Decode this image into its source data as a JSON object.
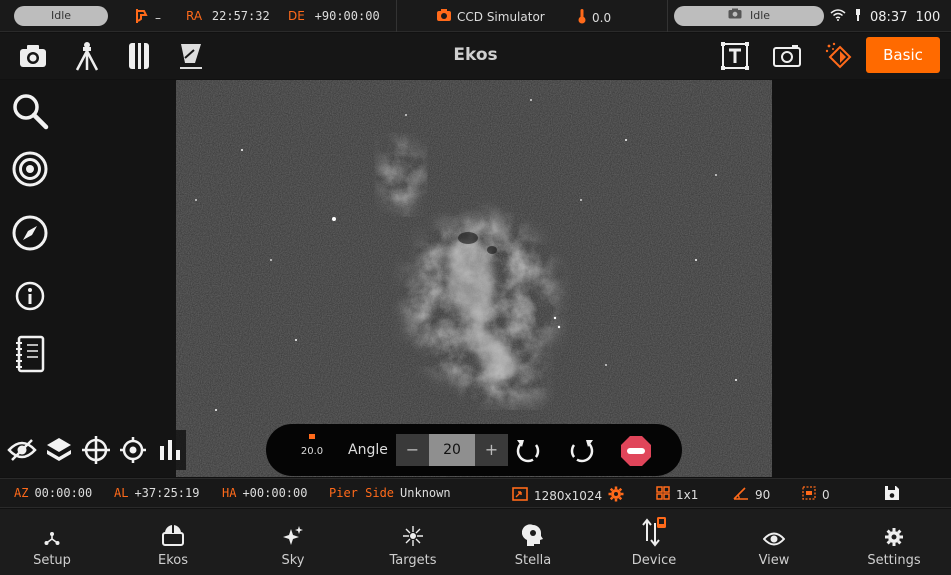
{
  "status": {
    "left_pill": "Idle",
    "mount_status": "–",
    "ra_label": "RA",
    "ra_value": "22:57:32",
    "de_label": "DE",
    "de_value": "+90:00:00",
    "camera_name": "CCD Simulator",
    "temperature": "0.0",
    "right_pill": "Idle",
    "time": "08:37",
    "battery": "100"
  },
  "toolbar": {
    "title": "Ekos",
    "basic_label": "Basic"
  },
  "rotation": {
    "indicator_value": "20.0",
    "angle_label": "Angle",
    "minus_label": "−",
    "angle_value": "20",
    "plus_label": "+"
  },
  "info": {
    "az_label": "AZ",
    "az_value": "00:00:00",
    "al_label": "AL",
    "al_value": "+37:25:19",
    "ha_label": "HA",
    "ha_value": "+00:00:00",
    "pier_label": "Pier Side",
    "pier_value": "Unknown",
    "resolution": "1280x1024",
    "binning": "1x1",
    "rotation": "90",
    "offset": "0"
  },
  "nav": [
    {
      "label": "Setup",
      "icon": "setup-icon"
    },
    {
      "label": "Ekos",
      "icon": "ekos-icon"
    },
    {
      "label": "Sky",
      "icon": "sky-icon"
    },
    {
      "label": "Targets",
      "icon": "targets-icon"
    },
    {
      "label": "Stella",
      "icon": "stella-icon"
    },
    {
      "label": "Device",
      "icon": "device-icon"
    },
    {
      "label": "View",
      "icon": "view-icon"
    },
    {
      "label": "Settings",
      "icon": "settings-icon"
    }
  ],
  "colors": {
    "accent": "#ff6a00",
    "stop": "#e0455a"
  }
}
